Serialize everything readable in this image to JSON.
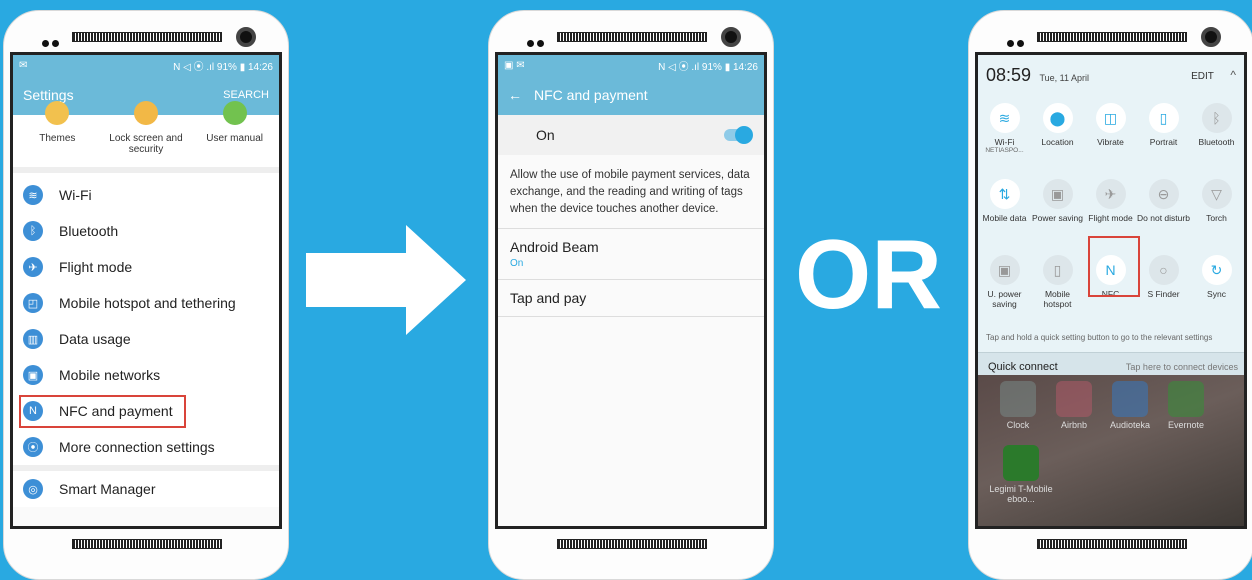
{
  "phone1": {
    "status": {
      "left": "✉",
      "right": "N ◁ ⦿ .ıl 91% ▮ 14:26"
    },
    "header": {
      "title": "Settings",
      "search": "SEARCH"
    },
    "shortcuts": [
      "Themes",
      "Lock screen and security",
      "User manual"
    ],
    "menu": [
      {
        "label": "Wi-Fi",
        "icon": "wifi-icon",
        "glyph": "≋"
      },
      {
        "label": "Bluetooth",
        "icon": "bluetooth-icon",
        "glyph": "ᛒ"
      },
      {
        "label": "Flight mode",
        "icon": "airplane-icon",
        "glyph": "✈"
      },
      {
        "label": "Mobile hotspot and tethering",
        "icon": "hotspot-icon",
        "glyph": "◰"
      },
      {
        "label": "Data usage",
        "icon": "data-usage-icon",
        "glyph": "▥"
      },
      {
        "label": "Mobile networks",
        "icon": "mobile-networks-icon",
        "glyph": "▣"
      },
      {
        "label": "NFC and payment",
        "icon": "nfc-icon",
        "glyph": "N"
      },
      {
        "label": "More connection settings",
        "icon": "more-connection-icon",
        "glyph": "⦿"
      },
      {
        "label": "Smart Manager",
        "icon": "smart-manager-icon",
        "glyph": "◎"
      }
    ]
  },
  "phone2": {
    "status": {
      "left": "▣ ✉",
      "right": "N ◁ ⦿ .ıl 91% ▮ 14:26"
    },
    "header": {
      "title": "NFC and payment"
    },
    "toggle": {
      "label": "On"
    },
    "description": "Allow the use of mobile payment services, data exchange, and the reading and writing of tags when the device touches another device.",
    "rows": [
      {
        "title": "Android Beam",
        "sub": "On"
      },
      {
        "title": "Tap and pay",
        "sub": ""
      }
    ]
  },
  "or_text": "OR",
  "phone3": {
    "time": "08:59",
    "date": "Tue, 11 April",
    "edit": "EDIT",
    "tiles": [
      {
        "label": "Wi-Fi",
        "sub": "NETIASPO...",
        "icon": "wifi-icon",
        "glyph": "≋",
        "on": true
      },
      {
        "label": "Location",
        "sub": "",
        "icon": "location-icon",
        "glyph": "⬤",
        "on": true
      },
      {
        "label": "Vibrate",
        "sub": "",
        "icon": "vibrate-icon",
        "glyph": "◫",
        "on": true
      },
      {
        "label": "Portrait",
        "sub": "",
        "icon": "portrait-icon",
        "glyph": "▯",
        "on": true
      },
      {
        "label": "Bluetooth",
        "sub": "",
        "icon": "bluetooth-icon",
        "glyph": "ᛒ",
        "on": false
      },
      {
        "label": "Mobile data",
        "sub": "",
        "icon": "mobile-data-icon",
        "glyph": "⇅",
        "on": true
      },
      {
        "label": "Power saving",
        "sub": "",
        "icon": "power-saving-icon",
        "glyph": "▣",
        "on": false
      },
      {
        "label": "Flight mode",
        "sub": "",
        "icon": "airplane-icon",
        "glyph": "✈",
        "on": false
      },
      {
        "label": "Do not disturb",
        "sub": "",
        "icon": "do-not-disturb-icon",
        "glyph": "⊖",
        "on": false
      },
      {
        "label": "Torch",
        "sub": "",
        "icon": "torch-icon",
        "glyph": "▽",
        "on": false
      },
      {
        "label": "U. power saving",
        "sub": "",
        "icon": "ultra-power-icon",
        "glyph": "▣",
        "on": false
      },
      {
        "label": "Mobile hotspot",
        "sub": "",
        "icon": "hotspot-icon",
        "glyph": "▯",
        "on": false
      },
      {
        "label": "NFC",
        "sub": "",
        "icon": "nfc-icon",
        "glyph": "N",
        "on": true
      },
      {
        "label": "S Finder",
        "sub": "",
        "icon": "search-icon",
        "glyph": "○",
        "on": false
      },
      {
        "label": "Sync",
        "sub": "",
        "icon": "sync-icon",
        "glyph": "↻",
        "on": true
      }
    ],
    "hint": "Tap and hold a quick setting button to go to the relevant settings",
    "quick_connect": {
      "label": "Quick connect",
      "sub": "Tap here to connect devices"
    },
    "apps": [
      {
        "label": "Clock",
        "color": "#7a8e8c"
      },
      {
        "label": "Airbnb",
        "color": "#b55a6a"
      },
      {
        "label": "Audioteka",
        "color": "#3b74b6"
      },
      {
        "label": "Evernote",
        "color": "#3a8a3a"
      },
      {
        "label": "Legimi T-Mobile eboo...",
        "color": "#2b7a2b"
      }
    ]
  }
}
